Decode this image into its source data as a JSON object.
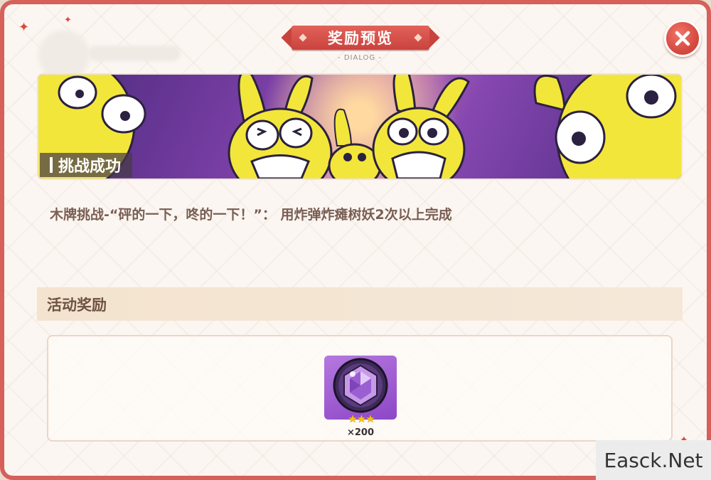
{
  "dialog": {
    "title": "奖励预览",
    "subtitle": "- DIALOG -",
    "close_icon": "close-x-icon"
  },
  "banner": {
    "label": "挑战成功",
    "art": "yellow-rabbit-characters-illustration"
  },
  "challenge": {
    "description": "木牌挑战-“砰的一下，咚的一下！”： 用炸弹炸瘫树妖2次以上完成"
  },
  "rewards_section": {
    "header": "活动奖励",
    "items": [
      {
        "icon": "purple-gem-orb-icon",
        "stars": "★★★",
        "quantity": "×200"
      }
    ]
  },
  "watermark": "Easck.Net",
  "colors": {
    "frame_border": "#d6605a",
    "title_red": "#c9433d",
    "section_header_bg": "#f3e3cf",
    "text_brown": "#7a5e53",
    "item_bg": "#9a55cf"
  }
}
